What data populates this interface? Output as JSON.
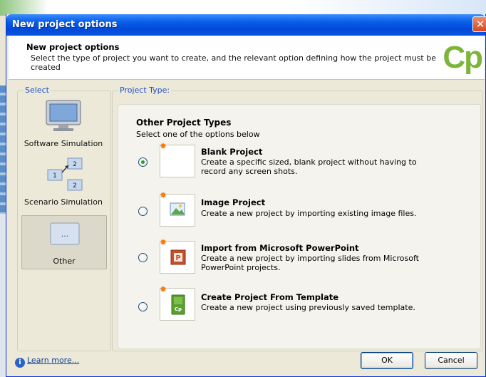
{
  "window": {
    "title": "New project options"
  },
  "header": {
    "title": "New project options",
    "description": "Select the type of project you want to create, and the relevant option defining how the project must be created",
    "logo_text": "Cp"
  },
  "select_group": {
    "label": "Select",
    "options": [
      {
        "label": "Software Simulation",
        "selected": false
      },
      {
        "label": "Scenario Simulation",
        "selected": false
      },
      {
        "label": "Other",
        "selected": true
      }
    ]
  },
  "project_type": {
    "label": "Project Type:",
    "section_title": "Other Project Types",
    "section_subtitle": "Select one of the options below",
    "items": [
      {
        "title": "Blank Project",
        "description": "Create a specific sized, blank project without having to record any screen shots.",
        "icon": "blank-page-icon",
        "selected": true
      },
      {
        "title": "Image Project",
        "description": "Create a new project by importing existing image files.",
        "icon": "image-icon",
        "selected": false
      },
      {
        "title": "Import from Microsoft PowerPoint",
        "description": "Create a new project by importing slides from Microsoft PowerPoint projects.",
        "icon": "powerpoint-icon",
        "selected": false
      },
      {
        "title": "Create Project From Template",
        "description": "Create a new project using previously saved template.",
        "icon": "template-icon",
        "selected": false
      }
    ]
  },
  "footer": {
    "learn_more": "Learn more...",
    "ok_label": "OK",
    "cancel_label": "Cancel"
  },
  "colors": {
    "titlebar": "#0a55e0",
    "group_label": "#1f4fc9",
    "logo": "#7db43a",
    "radio_dot": "#21a121"
  }
}
